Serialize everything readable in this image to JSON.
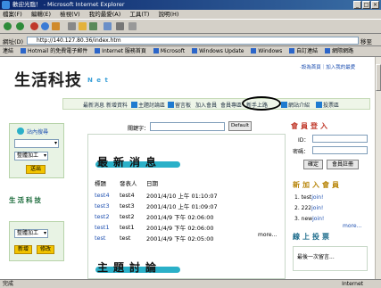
{
  "window": {
    "title": "歡迎光臨！ - Microsoft Internet Explorer",
    "controls": [
      "_",
      "□",
      "×"
    ]
  },
  "menu": [
    "檔案(F)",
    "編輯(E)",
    "檢視(V)",
    "我的最愛(A)",
    "工具(T)",
    "說明(H)"
  ],
  "address": {
    "label": "網址(D)",
    "value": "http://140.127.80.36/index.htm",
    "go_label": "移至"
  },
  "links_bar": [
    "連結",
    "Hotmail 的免費電子郵件",
    "Internet 服務首頁",
    "Microsoft",
    "Windows Update",
    "Windows",
    "自訂連結",
    "網際網路"
  ],
  "site": {
    "logo_text": "生活科技",
    "logo_sub": "N e t",
    "top_links": "‧設為首頁｜加入我的最愛",
    "nav": [
      "最新消息",
      "新增資料",
      "主題討論區",
      "留言板",
      "加入會員",
      "會員專區",
      "新手上路",
      "網站介紹",
      "投票區"
    ]
  },
  "left": {
    "online_title": "站內搜尋",
    "category_select": "整體加工",
    "submit_label": "送出",
    "section_title": "生活科技",
    "category_select_2": "整體加工",
    "btn_new": "新增",
    "btn_edit": "修改"
  },
  "center": {
    "keyword_label": "關鍵字：",
    "default_button": "Default",
    "section1_title": "最新消息",
    "columns": [
      "標題",
      "發表人",
      "日期"
    ],
    "rows": [
      [
        "test4",
        "test4",
        "2001/4/10 上午 01:10:07"
      ],
      [
        "test3",
        "test3",
        "2001/4/10 上午 01:09:07"
      ],
      [
        "test2",
        "test2",
        "2001/4/9 下午 02:06:00"
      ],
      [
        "test1",
        "test1",
        "2001/4/9 下午 02:06:00"
      ],
      [
        "test",
        "test",
        "2001/4/9 下午 02:05:00"
      ]
    ],
    "more": "more...",
    "section2_title": "主題討論"
  },
  "right": {
    "login_title": "會員登入",
    "id_label": "ID：",
    "pw_label": "密碼：",
    "btn_ok": "確定",
    "btn_register": "會員註冊",
    "new_title": "新加入會員",
    "list": [
      {
        "n": "1.",
        "name": "test",
        "tag": "join!"
      },
      {
        "n": "2.",
        "name": "222",
        "tag": "join!"
      },
      {
        "n": "3.",
        "name": "new",
        "tag": "join!"
      }
    ],
    "more": "more...",
    "poll_title": "線上投票",
    "poll_text": "最後一次留言..."
  },
  "status": {
    "text": "完成",
    "zone": "Internet"
  }
}
